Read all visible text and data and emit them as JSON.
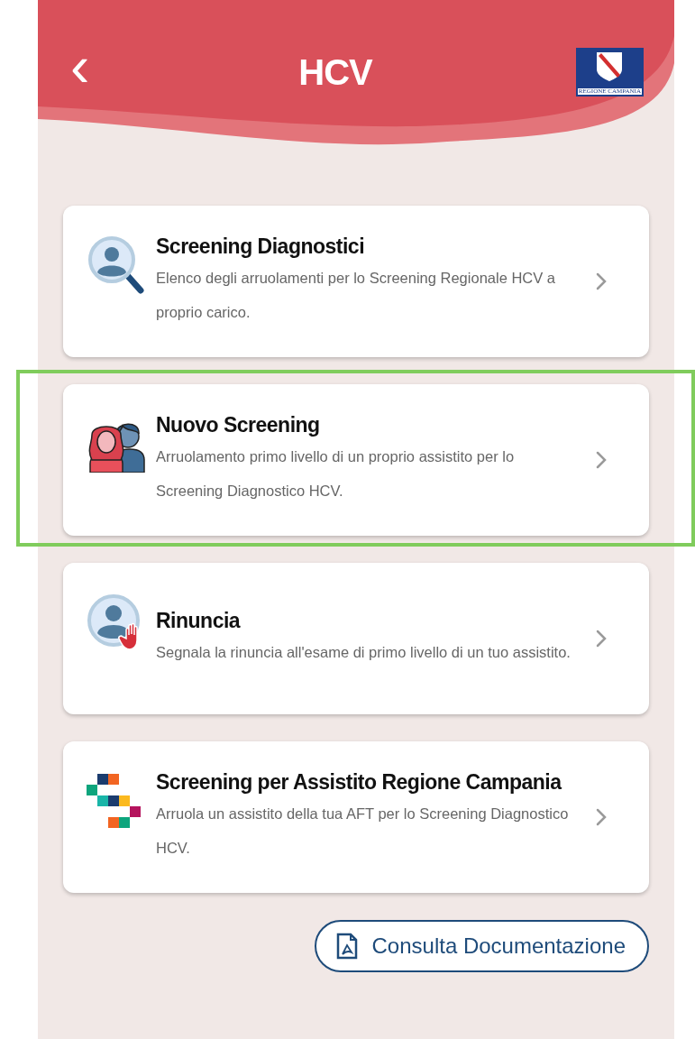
{
  "header": {
    "back_icon": "‹",
    "title": "HCV",
    "logo_text": "REGIONE CAMPANIA"
  },
  "menu_items": [
    {
      "kind": "search-person",
      "title": "Screening Diagnostici",
      "description": "Elenco degli arruolamenti per lo Screening Regionale HCV a proprio carico.",
      "highlighted": false
    },
    {
      "kind": "people",
      "title": "Nuovo Screening",
      "description": "Arruolamento primo livello di un proprio assistito per lo Screening Diagnostico HCV.",
      "highlighted": true
    },
    {
      "kind": "person-stop",
      "title": "Rinuncia",
      "description": "Segnala la rinuncia all'esame di primo livello di un tuo assistito.",
      "highlighted": false
    },
    {
      "kind": "squares",
      "title": "Screening per Assistito Regione Campania",
      "description": "Arruola un assistito della tua AFT per lo Screening Diagnostico HCV.",
      "highlighted": false
    }
  ],
  "doc_button": {
    "label": "Consulta Documentazione"
  }
}
